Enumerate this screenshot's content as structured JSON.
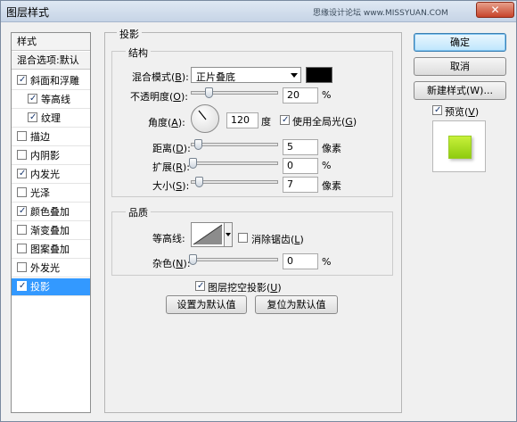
{
  "window": {
    "title": "图层样式",
    "watermark": "思缘设计论坛 www.MISSYUAN.COM",
    "close_glyph": "✕"
  },
  "sidebar": {
    "items": [
      {
        "label": "样式",
        "checkbox": false,
        "checked": false,
        "type": "head"
      },
      {
        "label": "混合选项:默认",
        "checkbox": false,
        "checked": false,
        "type": "head"
      },
      {
        "label": "斜面和浮雕",
        "checkbox": true,
        "checked": true,
        "type": "item"
      },
      {
        "label": "等高线",
        "checkbox": true,
        "checked": true,
        "type": "sub"
      },
      {
        "label": "纹理",
        "checkbox": true,
        "checked": true,
        "type": "sub"
      },
      {
        "label": "描边",
        "checkbox": true,
        "checked": false,
        "type": "item"
      },
      {
        "label": "内阴影",
        "checkbox": true,
        "checked": false,
        "type": "item"
      },
      {
        "label": "内发光",
        "checkbox": true,
        "checked": true,
        "type": "item"
      },
      {
        "label": "光泽",
        "checkbox": true,
        "checked": false,
        "type": "item"
      },
      {
        "label": "颜色叠加",
        "checkbox": true,
        "checked": true,
        "type": "item"
      },
      {
        "label": "渐变叠加",
        "checkbox": true,
        "checked": false,
        "type": "item"
      },
      {
        "label": "图案叠加",
        "checkbox": true,
        "checked": false,
        "type": "item"
      },
      {
        "label": "外发光",
        "checkbox": true,
        "checked": false,
        "type": "item"
      },
      {
        "label": "投影",
        "checkbox": true,
        "checked": true,
        "type": "item",
        "selected": true
      }
    ]
  },
  "panel": {
    "title": "投影",
    "structure": {
      "legend": "结构",
      "blend_mode_label": "混合模式(",
      "blend_mode_key": "B",
      "blend_mode_value": "正片叠底",
      "shadow_color": "#000000",
      "opacity_label": "不透明度(",
      "opacity_key": "O",
      "opacity_value": "20",
      "opacity_unit": "%",
      "angle_label": "角度(",
      "angle_key": "A",
      "angle_value": "120",
      "angle_unit": "度",
      "global_light_label": "使用全局光(",
      "global_light_key": "G",
      "global_light_checked": true,
      "distance_label": "距离(",
      "distance_key": "D",
      "distance_value": "5",
      "distance_unit": "像素",
      "spread_label": "扩展(",
      "spread_key": "R",
      "spread_value": "0",
      "spread_unit": "%",
      "size_label": "大小(",
      "size_key": "S",
      "size_value": "7",
      "size_unit": "像素"
    },
    "quality": {
      "legend": "品质",
      "contour_label": "等高线:",
      "antialias_label": "消除锯齿(",
      "antialias_key": "L",
      "antialias_checked": false,
      "noise_label": "杂色(",
      "noise_key": "N",
      "noise_value": "0",
      "noise_unit": "%"
    },
    "knockout_label": "图层挖空投影(",
    "knockout_key": "U",
    "knockout_checked": true,
    "set_default_label": "设置为默认值",
    "reset_default_label": "复位为默认值"
  },
  "buttons": {
    "ok": "确定",
    "cancel": "取消",
    "new_style": "新建样式(W)...",
    "preview_label": "预览(",
    "preview_key": "V",
    "preview_checked": true
  },
  "colors": {
    "accent_selection": "#3399ff",
    "preview_green": "#a6dd1f"
  }
}
